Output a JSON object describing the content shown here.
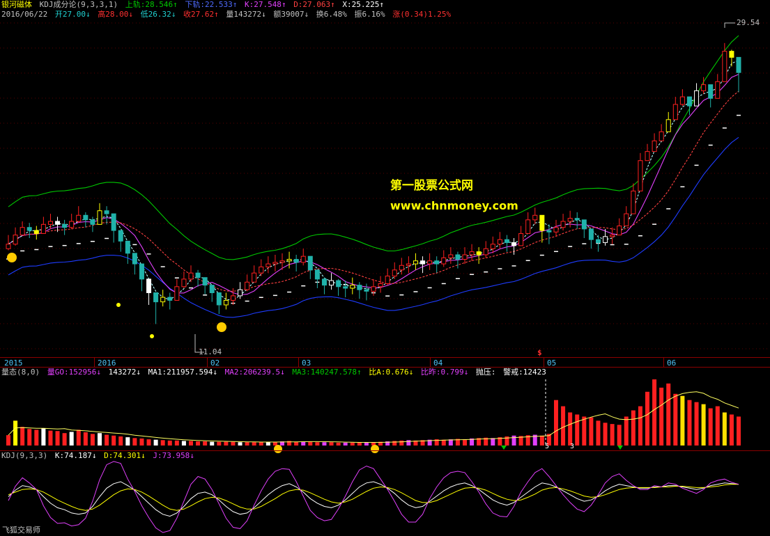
{
  "main_header": {
    "name": "银河磁体",
    "indicator": "KDJ成分论(9,3,3,1)",
    "upper": "上轨:28.546",
    "lower": "下轨:22.533",
    "k": "K:27.548",
    "d": "D:27.063",
    "x": "X:25.225"
  },
  "quote": {
    "date": "2016/06/22",
    "open": "开27.00",
    "high": "高28.00",
    "low": "低26.32",
    "close": "收27.62",
    "volume": "量143272",
    "amount": "额39007",
    "turnover": "换6.48%",
    "amplitude": "振6.16%",
    "change": "涨(0.34)1.25%"
  },
  "watermark": {
    "line1": "第一股票公式网",
    "line2": "www.chnmoney.com"
  },
  "annotations": {
    "high_label": "29.54",
    "low_label": "11.04",
    "dollar": "$"
  },
  "x_axis": [
    "2015",
    "2016",
    "02",
    "03",
    "04",
    "05",
    "06"
  ],
  "volume_header": {
    "title": "量态(8,0)",
    "vol": "量GO:152956",
    "vol2": "143272",
    "ma1": "MA1:211957.594",
    "ma2": "MA2:206239.5",
    "ma3": "MA3:140247.578",
    "ratio_a": "比A:0.676",
    "ratio_prev": "比昨:0.799",
    "pressure": "抛压",
    "alert": "警戒:12423"
  },
  "volume_marks": {
    "five": "5",
    "three": "3"
  },
  "kdj_header": {
    "title": "KDJ(9,3,3)",
    "k": "K:74.187",
    "d": "D:74.301",
    "j": "J:73.958"
  },
  "footer": "飞狐交易师",
  "colors": {
    "up": "#ff2020",
    "down": "#20b2aa",
    "white": "#ffffff",
    "yellow": "#ffff00",
    "green": "#00c800",
    "blue": "#1e3cff",
    "magenta": "#e040fb",
    "axis": "#8b0000"
  },
  "chart_data": [
    {
      "type": "candlestick",
      "title": "",
      "ylim": [
        9,
        31
      ],
      "x": [
        "2015",
        "2016",
        "02",
        "03",
        "04",
        "05",
        "06"
      ],
      "close": [
        16.3,
        16.9,
        17.4,
        17.2,
        17.0,
        17.6,
        17.8,
        17.6,
        17.4,
        17.8,
        18.2,
        17.9,
        17.6,
        18.5,
        18.3,
        17.2,
        16.5,
        15.7,
        15.0,
        14.0,
        13.1,
        12.5,
        12.8,
        12.6,
        13.5,
        14.0,
        14.4,
        14.1,
        13.6,
        13.1,
        12.3,
        12.6,
        12.9,
        13.3,
        13.8,
        14.4,
        14.8,
        15.0,
        15.1,
        15.2,
        15.3,
        15.1,
        15.5,
        14.6,
        14.0,
        13.6,
        13.9,
        13.5,
        13.4,
        13.6,
        13.3,
        13.2,
        13.5,
        13.7,
        14.2,
        14.6,
        14.9,
        15.0,
        15.2,
        15.0,
        15.2,
        15.0,
        15.4,
        15.6,
        15.3,
        15.6,
        15.8,
        15.6,
        16.0,
        16.3,
        16.6,
        16.4,
        16.2,
        17.0,
        17.9,
        18.2,
        17.2,
        17.1,
        17.4,
        17.8,
        18.0,
        17.9,
        17.3,
        16.6,
        16.4,
        16.8,
        16.9,
        17.5,
        18.3,
        19.8,
        21.8,
        22.4,
        23.1,
        23.7,
        24.5,
        25.5,
        26.0,
        25.4,
        26.4,
        26.8,
        25.9,
        27.0,
        29.0,
        28.6,
        27.6
      ],
      "high": [
        16.9,
        17.4,
        17.8,
        17.7,
        17.5,
        18.1,
        18.3,
        18.1,
        17.9,
        18.3,
        18.8,
        18.4,
        18.1,
        19.0,
        18.8,
        17.8,
        17.0,
        16.2,
        15.5,
        14.5,
        13.6,
        13.0,
        13.3,
        13.1,
        14.0,
        14.5,
        14.9,
        14.6,
        14.1,
        13.6,
        12.8,
        13.1,
        13.4,
        13.8,
        14.3,
        14.9,
        15.3,
        15.5,
        15.6,
        15.7,
        15.8,
        15.6,
        16.0,
        15.1,
        14.5,
        14.1,
        14.4,
        14.0,
        13.9,
        14.1,
        13.8,
        13.7,
        14.0,
        14.2,
        14.7,
        15.1,
        15.4,
        15.5,
        15.7,
        15.5,
        15.7,
        15.5,
        15.9,
        16.1,
        15.8,
        16.1,
        16.3,
        16.1,
        16.5,
        16.8,
        17.1,
        16.9,
        16.7,
        17.5,
        18.4,
        18.7,
        17.7,
        17.6,
        17.9,
        18.3,
        18.5,
        18.4,
        17.8,
        17.1,
        16.9,
        17.3,
        17.4,
        18.0,
        18.8,
        20.3,
        22.3,
        22.9,
        23.6,
        24.2,
        25.0,
        26.0,
        26.5,
        25.9,
        26.9,
        27.3,
        26.4,
        27.5,
        29.54,
        29.1,
        28.0
      ],
      "low": [
        15.9,
        16.2,
        16.9,
        16.7,
        16.6,
        17.1,
        17.3,
        17.1,
        16.9,
        17.3,
        17.7,
        17.4,
        17.1,
        18.0,
        17.6,
        16.4,
        15.8,
        15.0,
        14.3,
        13.2,
        12.3,
        11.04,
        12.2,
        12.0,
        12.9,
        13.4,
        13.8,
        13.5,
        13.0,
        12.5,
        11.7,
        12.0,
        12.3,
        12.7,
        13.2,
        13.8,
        14.2,
        14.4,
        14.5,
        14.6,
        14.7,
        14.5,
        14.9,
        14.0,
        13.4,
        13.0,
        13.3,
        12.9,
        12.8,
        13.0,
        12.7,
        12.6,
        12.9,
        13.1,
        13.6,
        14.0,
        14.3,
        14.4,
        14.6,
        14.4,
        14.6,
        14.4,
        14.8,
        15.0,
        14.7,
        15.0,
        15.2,
        15.0,
        15.4,
        15.7,
        16.0,
        15.8,
        15.6,
        16.4,
        17.3,
        17.6,
        16.4,
        16.3,
        16.8,
        17.2,
        17.4,
        17.3,
        16.7,
        16.0,
        15.8,
        16.2,
        16.3,
        16.9,
        17.7,
        19.2,
        21.2,
        21.8,
        22.5,
        23.1,
        23.9,
        24.9,
        25.4,
        24.8,
        25.8,
        26.2,
        25.3,
        26.4,
        28.4,
        28.0,
        26.3
      ]
    },
    {
      "type": "bar",
      "title": "量态(8,0)",
      "series": [
        {
          "name": "量GO",
          "values": [
            25,
            60,
            45,
            40,
            38,
            42,
            36,
            35,
            30,
            33,
            38,
            32,
            28,
            30,
            26,
            24,
            22,
            20,
            18,
            17,
            15,
            14,
            13,
            12,
            12,
            11,
            11,
            10,
            10,
            9,
            9,
            9,
            9,
            8,
            8,
            8,
            8,
            9,
            9,
            10,
            11,
            9,
            10,
            9,
            8,
            8,
            8,
            7,
            7,
            7,
            7,
            8,
            8,
            9,
            10,
            11,
            12,
            13,
            12,
            13,
            14,
            15,
            14,
            15,
            16,
            15,
            17,
            18,
            19,
            18,
            20,
            22,
            24,
            23,
            25,
            26,
            24,
            28,
            110,
            95,
            80,
            75,
            70,
            68,
            60,
            55,
            52,
            50,
            70,
            85,
            95,
            130,
            160,
            140,
            150,
            125,
            120,
            110,
            105,
            100,
            90,
            95,
            80,
            75,
            70
          ]
        }
      ]
    },
    {
      "type": "line",
      "title": "KDJ(9,3,3)",
      "series": [
        {
          "name": "K",
          "values": [
            55,
            65,
            72,
            70,
            66,
            55,
            45,
            38,
            35,
            30,
            28,
            30,
            40,
            55,
            68,
            75,
            78,
            72,
            65,
            55,
            45,
            35,
            28,
            25,
            30,
            40,
            52,
            60,
            62,
            58,
            50,
            40,
            32,
            28,
            30,
            38,
            48,
            58,
            66,
            72,
            75,
            70,
            62,
            52,
            45,
            40,
            38,
            42,
            50,
            60,
            70,
            76,
            78,
            74,
            68,
            60,
            50,
            42,
            38,
            40,
            48,
            56,
            64,
            70,
            74,
            76,
            72,
            66,
            58,
            50,
            45,
            42,
            46,
            54,
            62,
            70,
            76,
            74,
            70,
            64,
            58,
            52,
            48,
            50,
            56,
            64,
            70,
            74,
            72,
            70,
            68,
            68,
            70,
            70,
            72,
            72,
            70,
            68,
            66,
            68,
            72,
            74,
            76,
            75,
            74
          ]
        },
        {
          "name": "D",
          "values": [
            58,
            62,
            66,
            67,
            66,
            62,
            56,
            50,
            45,
            40,
            36,
            34,
            36,
            42,
            50,
            58,
            64,
            67,
            66,
            62,
            56,
            49,
            42,
            36,
            34,
            36,
            41,
            47,
            52,
            54,
            53,
            49,
            44,
            39,
            36,
            36,
            40,
            46,
            52,
            59,
            64,
            66,
            65,
            61,
            56,
            51,
            47,
            45,
            47,
            51,
            57,
            63,
            68,
            70,
            69,
            66,
            61,
            55,
            49,
            46,
            46,
            49,
            54,
            59,
            64,
            68,
            69,
            68,
            65,
            60,
            55,
            51,
            49,
            50,
            54,
            59,
            65,
            68,
            69,
            67,
            64,
            60,
            56,
            54,
            55,
            58,
            62,
            66,
            68,
            69,
            69,
            69,
            69,
            70,
            70,
            71,
            71,
            70,
            69,
            69,
            70,
            71,
            73,
            74,
            74
          ]
        },
        {
          "name": "J",
          "values": [
            49,
            71,
            84,
            76,
            66,
            41,
            23,
            14,
            15,
            10,
            12,
            22,
            48,
            81,
            104,
            109,
            106,
            82,
            63,
            41,
            23,
            7,
            0,
            3,
            22,
            48,
            74,
            86,
            82,
            66,
            44,
            22,
            8,
            6,
            18,
            42,
            64,
            82,
            94,
            98,
            97,
            78,
            56,
            34,
            23,
            18,
            20,
            36,
            56,
            78,
            96,
            102,
            98,
            82,
            66,
            48,
            28,
            16,
            16,
            28,
            52,
            70,
            84,
            92,
            94,
            92,
            78,
            62,
            44,
            30,
            25,
            24,
            40,
            62,
            78,
            92,
            98,
            86,
            72,
            58,
            46,
            36,
            32,
            42,
            58,
            76,
            86,
            90,
            80,
            72,
            66,
            66,
            72,
            70,
            76,
            74,
            68,
            64,
            60,
            66,
            76,
            80,
            82,
            77,
            74
          ]
        }
      ]
    }
  ]
}
